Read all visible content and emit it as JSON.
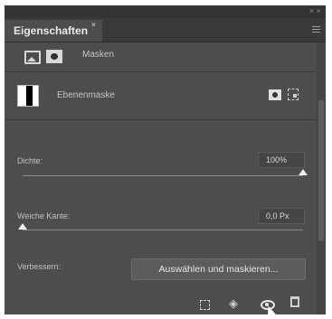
{
  "window": {
    "close_glyph": "× ×"
  },
  "panel": {
    "tab_title": "Eigenschaften",
    "tab_close_glyph": "×"
  },
  "header": {
    "label": "Masken",
    "icons": [
      "pixel-mask-icon",
      "layer-mask-icon"
    ]
  },
  "layer": {
    "label": "Ebenenmaske",
    "icons": [
      "select-mask-icon",
      "vector-mask-icon"
    ]
  },
  "density": {
    "label": "Dichte:",
    "value": "100%",
    "slider_fraction": 1.0
  },
  "feather": {
    "label": "Weiche Kante:",
    "value": "0,0 Px",
    "slider_fraction": 0.0
  },
  "refine": {
    "label": "Verbessern:",
    "button_label": "Auswählen und maskieren..."
  },
  "footer": {
    "icons": [
      "load-selection-icon",
      "apply-mask-icon",
      "toggle-mask-visibility-icon",
      "delete-mask-icon"
    ]
  },
  "colors": {
    "panel_bg": "#4d4d4d",
    "tab_bar_bg": "#3a3a3a",
    "text": "#c4c4c4"
  }
}
